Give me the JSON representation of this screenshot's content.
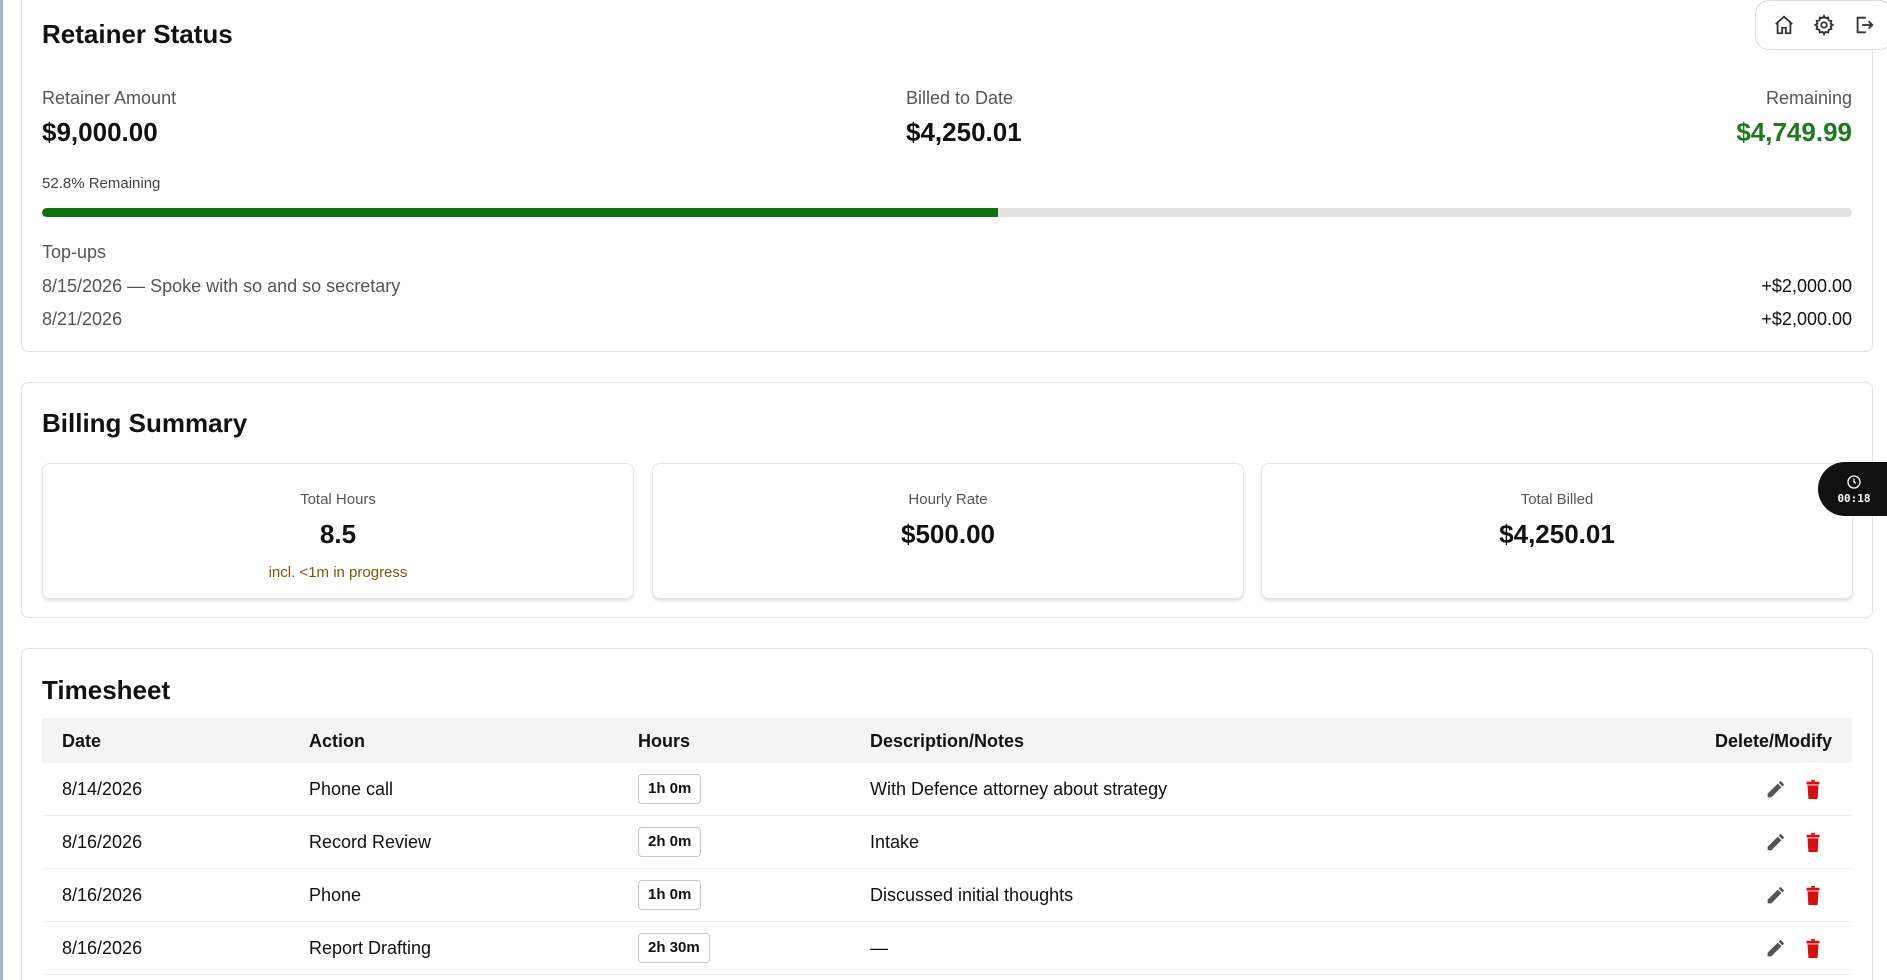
{
  "retainer": {
    "title": "Retainer Status",
    "amount_label": "Retainer Amount",
    "amount_value": "$9,000.00",
    "billed_label": "Billed to Date",
    "billed_value": "$4,250.01",
    "remaining_label": "Remaining",
    "remaining_value": "$4,749.99",
    "remaining_percent_label": "52.8% Remaining",
    "progress_fraction": 0.528,
    "topups_title": "Top-ups",
    "topups": [
      {
        "label": "8/15/2026 — Spoke with so and so secretary",
        "amount": "+$2,000.00"
      },
      {
        "label": "8/21/2026",
        "amount": "+$2,000.00"
      }
    ]
  },
  "toolbar": {
    "icons": [
      "home-icon",
      "gear-icon",
      "logout-icon"
    ]
  },
  "billing": {
    "title": "Billing Summary",
    "total_hours_label": "Total Hours",
    "total_hours_value": "8.5",
    "total_hours_note": "incl. <1m in progress",
    "hourly_rate_label": "Hourly Rate",
    "hourly_rate_value": "$500.00",
    "total_billed_label": "Total Billed",
    "total_billed_value": "$4,250.01"
  },
  "timer": {
    "time": "00:18"
  },
  "timesheet": {
    "title": "Timesheet",
    "columns": [
      "Date",
      "Action",
      "Hours",
      "Description/Notes",
      "Delete/Modify"
    ],
    "rows": [
      {
        "date": "8/14/2026",
        "action": "Phone call",
        "hours": "1h 0m",
        "notes": "With Defence attorney about strategy"
      },
      {
        "date": "8/16/2026",
        "action": "Record Review",
        "hours": "2h 0m",
        "notes": "Intake"
      },
      {
        "date": "8/16/2026",
        "action": "Phone",
        "hours": "1h 0m",
        "notes": "Discussed initial thoughts"
      },
      {
        "date": "8/16/2026",
        "action": "Report Drafting",
        "hours": "2h 30m",
        "notes": "—"
      }
    ]
  },
  "colors": {
    "accent_green": "#0f700f",
    "remaining_green": "#1c7a1c",
    "delete_red": "#d40f0f",
    "note_brown": "#7a5a10"
  }
}
